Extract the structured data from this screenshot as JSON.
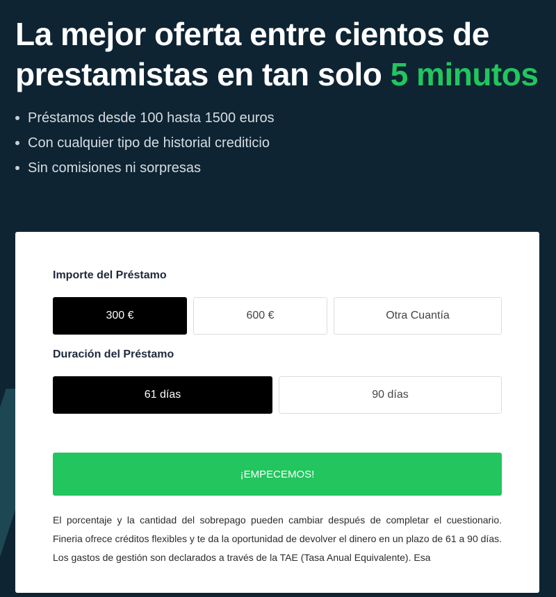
{
  "hero": {
    "headline_part1": "La mejor oferta entre cientos de prestamistas en tan solo ",
    "headline_accent": "5 minutos",
    "bullets": [
      "Préstamos desde 100 hasta 1500 euros",
      "Con cualquier tipo de historial crediticio",
      "Sin comisiones ni sorpresas"
    ]
  },
  "form": {
    "amount_label": "Importe del Préstamo",
    "amount_options": [
      "300 €",
      "600 €",
      "Otra Cuantía"
    ],
    "amount_selected": "300 €",
    "duration_label": "Duración del Préstamo",
    "duration_options": [
      "61 días",
      "90 días"
    ],
    "duration_selected": "61 días",
    "cta_label": "¡EMPECEMOS!"
  },
  "disclaimer": "El porcentaje y la cantidad del sobrepago pueden cambiar después de completar el cuestionario. Fineria ofrece créditos flexibles y te da la oportunidad de devolver el dinero en un plazo de 61 a 90 días. Los gastos de gestión son declarados a través de la TAE (Tasa Anual Equivalente). Esa",
  "colors": {
    "background": "#0e2433",
    "accent": "#22c55e",
    "selected": "#000000"
  }
}
